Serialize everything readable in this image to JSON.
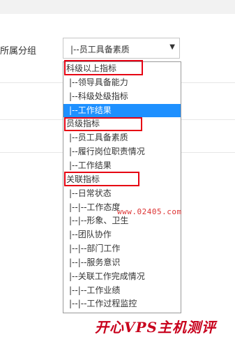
{
  "form": {
    "label": "所属分组",
    "selected_value": "|--员工具备素质"
  },
  "dropdown": {
    "options": [
      {
        "text": "科级以上指标",
        "kind": "group"
      },
      {
        "text": "|--领导具备能力",
        "kind": "option"
      },
      {
        "text": "|--科级处级指标",
        "kind": "option"
      },
      {
        "text": "|--工作结果",
        "kind": "option",
        "selected": true
      },
      {
        "text": "员级指标",
        "kind": "group"
      },
      {
        "text": "|--员工具备素质",
        "kind": "option"
      },
      {
        "text": "|--履行岗位职责情况",
        "kind": "option"
      },
      {
        "text": "|--工作结果",
        "kind": "option"
      },
      {
        "text": "关联指标",
        "kind": "group"
      },
      {
        "text": "|--日常状态",
        "kind": "option"
      },
      {
        "text": "|--|--工作态度",
        "kind": "option"
      },
      {
        "text": "|--|--形象、卫生",
        "kind": "option"
      },
      {
        "text": "|--团队协作",
        "kind": "option"
      },
      {
        "text": "|--|--部门工作",
        "kind": "option"
      },
      {
        "text": "|--|--服务意识",
        "kind": "option"
      },
      {
        "text": "|--关联工作完成情况",
        "kind": "option"
      },
      {
        "text": "|--|--工作业绩",
        "kind": "option"
      },
      {
        "text": "|--|--工作过程监控",
        "kind": "option"
      }
    ]
  },
  "watermark": {
    "text": "www.02405.com"
  },
  "brand": {
    "text": "开心VPS主机测评"
  },
  "colors": {
    "selected_bg": "#1e90ff",
    "annotation_red": "#e60012",
    "brand_red": "#c8001c"
  }
}
